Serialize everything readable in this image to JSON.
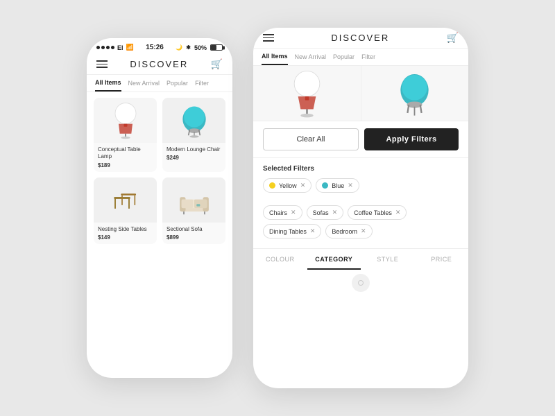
{
  "colors": {
    "background": "#e8e8e8",
    "phone_bg": "#ffffff",
    "black": "#222222",
    "gray_light": "#f5f5f5",
    "yellow": "#f5d020",
    "teal": "#3bb8c3"
  },
  "left_phone": {
    "status": {
      "time": "15:26",
      "battery": "50%",
      "carrier": "El"
    },
    "header": {
      "title": "DISCOVER",
      "hamburger_label": "menu",
      "cart_label": "cart"
    },
    "tabs": [
      {
        "label": "All Items",
        "active": true
      },
      {
        "label": "New Arrival",
        "active": false
      },
      {
        "label": "Popular",
        "active": false
      },
      {
        "label": "Filter",
        "active": false
      }
    ],
    "products": [
      {
        "name": "Conceptual Table Lamp",
        "price": "$189",
        "type": "lamp"
      },
      {
        "name": "Modern Lounge Chair",
        "price": "$249",
        "type": "chair"
      },
      {
        "name": "Nesting Side Tables",
        "price": "$149",
        "type": "tables"
      },
      {
        "name": "Sectional Sofa",
        "price": "$899",
        "type": "sofa"
      }
    ]
  },
  "right_phone": {
    "header": {
      "title": "DISCOVER",
      "hamburger_label": "menu",
      "cart_label": "cart"
    },
    "tabs": [
      {
        "label": "All Items",
        "active": true
      },
      {
        "label": "New Arrival",
        "active": false
      },
      {
        "label": "Popular",
        "active": false
      },
      {
        "label": "Filter",
        "active": false
      }
    ],
    "filter_buttons": {
      "clear_label": "Clear All",
      "apply_label": "Apply Filters"
    },
    "selected_filters_title": "Selected Filters",
    "color_tags": [
      {
        "label": "Yellow",
        "color": "#f5d020"
      },
      {
        "label": "Blue",
        "color": "#3bb8c3"
      }
    ],
    "category_tags": [
      {
        "label": "Chairs"
      },
      {
        "label": "Sofas"
      },
      {
        "label": "Coffee Tables"
      },
      {
        "label": "Dining Tables"
      },
      {
        "label": "Bedroom"
      }
    ],
    "filter_tabs": [
      {
        "label": "COLOUR",
        "active": false
      },
      {
        "label": "CATEGORY",
        "active": true
      },
      {
        "label": "STYLE",
        "active": false
      },
      {
        "label": "PRICE",
        "active": false
      }
    ]
  }
}
